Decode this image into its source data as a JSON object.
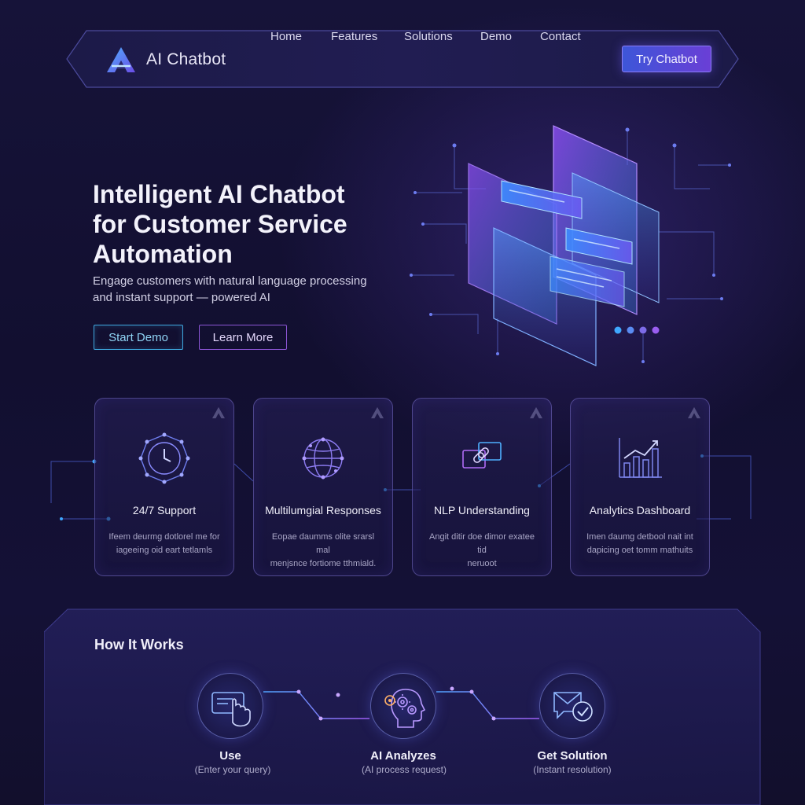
{
  "nav": {
    "brand": "AI Chatbot",
    "links": [
      "Home",
      "Features",
      "Solutions",
      "Demo",
      "Contact"
    ],
    "cta": "Try Chatbot"
  },
  "hero": {
    "title_lines": [
      "Intelligent AI Chatbot",
      "for Customer Service",
      "Automation"
    ],
    "subtitle_lines": [
      "Engage customers with natural language processing",
      "and instant support — powered AI"
    ],
    "primary_button": "Start Demo",
    "secondary_button": "Learn More",
    "carousel_dots": 4
  },
  "features": [
    {
      "icon": "clock-network-icon",
      "title": "24/7 Support",
      "desc_lines": [
        "Ifeem deurmg dotlorel me for",
        "iageeing oid eart tetlamls"
      ]
    },
    {
      "icon": "globe-network-icon",
      "title": "Multilumgial Responses",
      "desc_lines": [
        "Eopae daumms olite srarsl mal",
        "menjsnce fortiome tthmiald."
      ]
    },
    {
      "icon": "linked-windows-icon",
      "title": "NLP Understanding",
      "desc_lines": [
        "Angit ditir doe dimor exatee tid",
        "neruoot"
      ]
    },
    {
      "icon": "bar-chart-icon",
      "title": "Analytics Dashboard",
      "desc_lines": [
        "Imen daumg detbool nait int",
        "dapicing oet tomm mathuits"
      ]
    }
  ],
  "how_it_works": {
    "title": "How It Works",
    "steps": [
      {
        "icon": "hand-click-icon",
        "title": "Use",
        "subtitle": "(Enter your query)"
      },
      {
        "icon": "ai-head-gears-icon",
        "title": "AI Analyzes",
        "subtitle": "(AI process request)"
      },
      {
        "icon": "message-check-icon",
        "title": "Get Solution",
        "subtitle": "(Instant resolution)"
      }
    ]
  },
  "colors": {
    "background": "#141136",
    "accent_blue": "#3fa8df",
    "accent_purple": "#8d56d6",
    "cta_gradient_start": "#3d56d8",
    "cta_gradient_end": "#6a3fd6"
  }
}
